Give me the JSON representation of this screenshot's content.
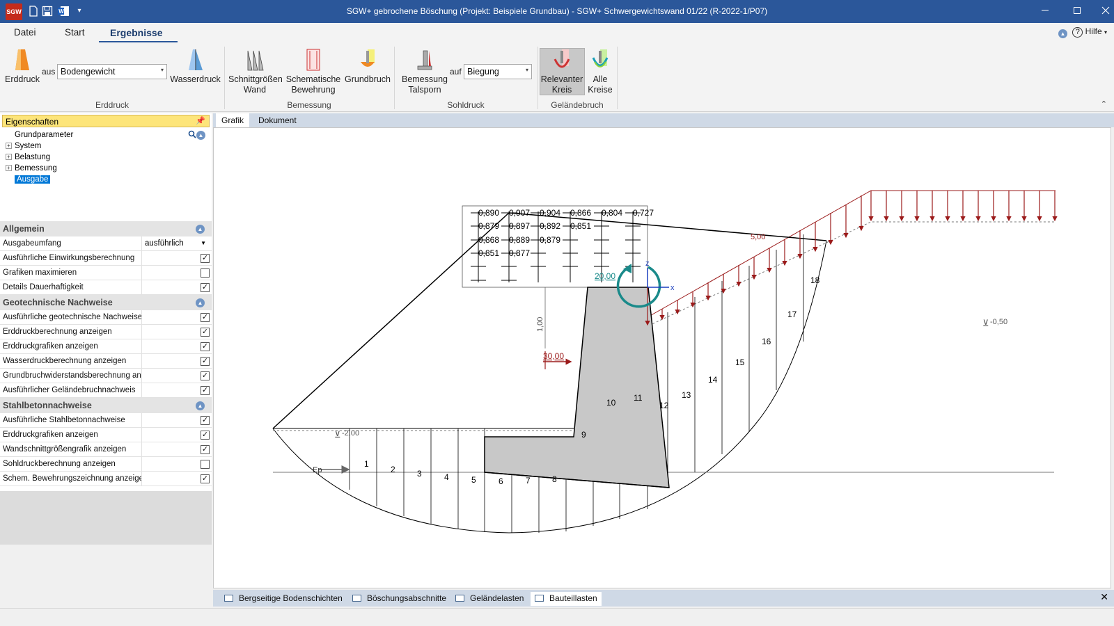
{
  "titlebar": {
    "logo": "SGW",
    "title": "SGW+ gebrochene Böschung (Projekt: Beispiele Grundbau) - SGW+ Schwergewichtswand 01/22 (R-2022-1/P07)",
    "quick_access": [
      "new-file-icon",
      "save-icon",
      "word-export-icon",
      "customize-dropdown-icon"
    ],
    "controls": [
      "minimize-icon",
      "maximize-icon",
      "close-icon"
    ]
  },
  "menu": {
    "tabs": [
      "Datei",
      "Start",
      "Ergebnisse"
    ],
    "active": "Ergebnisse",
    "help": "Hilfe"
  },
  "ribbon": {
    "erddruck_btn": "Erddruck",
    "aus_label": "aus",
    "aus_select": "Bodengewicht",
    "wasserdruck_btn": "Wasserdruck",
    "group_erddruck": "Erddruck",
    "schnitt_l1": "Schnittgrößen",
    "schnitt_l2": "Wand",
    "schem_l1": "Schematische",
    "schem_l2": "Bewehrung",
    "grundbruch_btn": "Grundbruch",
    "group_bemessung": "Bemessung",
    "bemessung_l1": "Bemessung",
    "bemessung_l2": "Talsporn",
    "auf_label": "auf",
    "auf_select": "Biegung",
    "group_sohldruck": "Sohldruck",
    "relevanter_l1": "Relevanter",
    "relevanter_l2": "Kreis",
    "alle_l1": "Alle",
    "alle_l2": "Kreise",
    "group_gelaendebruch": "Geländebruch"
  },
  "left": {
    "header": "Eigenschaften",
    "tree": [
      "Grundparameter",
      "System",
      "Belastung",
      "Bemessung",
      "Ausgabe"
    ],
    "selected": "Ausgabe",
    "sections": [
      {
        "title": "Allgemein",
        "rows": [
          {
            "label": "Ausgabeumfang",
            "value": "ausführlich"
          },
          {
            "label": "Ausführliche Einwirkungsberechnung",
            "checked": true
          },
          {
            "label": "Grafiken maximieren",
            "checked": false
          },
          {
            "label": "Details Dauerhaftigkeit",
            "checked": true
          }
        ]
      },
      {
        "title": "Geotechnische Nachweise",
        "rows": [
          {
            "label": "Ausführliche geotechnische Nachweise",
            "checked": true
          },
          {
            "label": "Erddruckberechnung anzeigen",
            "checked": true
          },
          {
            "label": "Erddruckgrafiken anzeigen",
            "checked": true
          },
          {
            "label": "Wasserdruckberechnung anzeigen",
            "checked": true
          },
          {
            "label": "Grundbruchwiderstandsberechnung anzeigen",
            "checked": true
          },
          {
            "label": "Ausführlicher Geländebruchnachweis",
            "checked": true
          }
        ]
      },
      {
        "title": "Stahlbetonnachweise",
        "rows": [
          {
            "label": "Ausführliche Stahlbetonnachweise",
            "checked": true
          },
          {
            "label": "Erddruckgrafiken anzeigen",
            "checked": true
          },
          {
            "label": "Wandschnittgrößengrafik anzeigen",
            "checked": true
          },
          {
            "label": "Sohldruckberechnung anzeigen",
            "checked": false
          },
          {
            "label": "Schem. Bewehrungszeichnung anzeigen",
            "checked": true
          }
        ]
      }
    ]
  },
  "content": {
    "tabs": [
      "Grafik",
      "Dokument"
    ],
    "active": "Grafik"
  },
  "drawing": {
    "utilization_rows": [
      [
        "0,890",
        "0,907",
        "0,904",
        "0,866",
        "0,804",
        "0,727"
      ],
      [
        "0,879",
        "0,897",
        "0,892",
        "0,851"
      ],
      [
        "0,868",
        "0,889",
        "0,879"
      ],
      [
        "0,851",
        "0,877"
      ]
    ],
    "slice_numbers": [
      "1",
      "2",
      "3",
      "4",
      "5",
      "6",
      "7",
      "8",
      "9",
      "10",
      "11",
      "12",
      "13",
      "14",
      "15",
      "16",
      "17",
      "18"
    ],
    "load_20": "20,00",
    "load_30": "30,00",
    "load_5": "5,00",
    "dim_100": "1,00",
    "gw_left": "-2,00",
    "gw_right": "-0,50",
    "ep_label": "Ep",
    "axis_x": "x",
    "axis_z": "z",
    "colors": {
      "load": "#9b1b1b",
      "circle": "#1a8a8a",
      "wall": "#c8c8c8"
    }
  },
  "bottom_tabs": [
    "Bergseitige Bodenschichten",
    "Böschungsabschnitte",
    "Geländelasten",
    "Bauteillasten"
  ],
  "bottom_active": "Bauteillasten"
}
